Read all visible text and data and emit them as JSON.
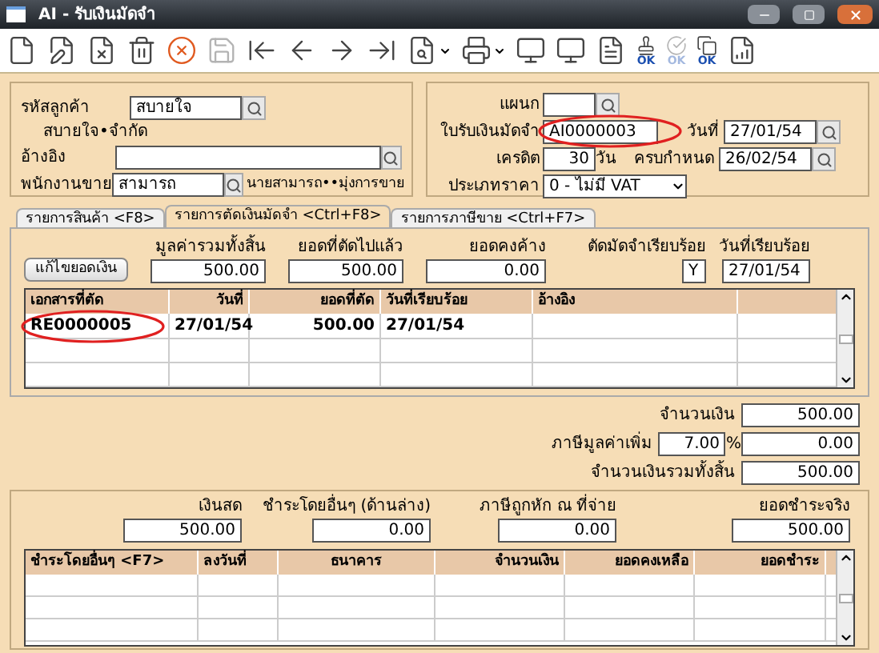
{
  "window": {
    "title": "AI - รับเงินมัดจำ"
  },
  "toolbar": [
    {
      "kind": "new",
      "disabled": false
    },
    {
      "kind": "edit",
      "disabled": false
    },
    {
      "kind": "void",
      "disabled": false
    },
    {
      "kind": "trash",
      "disabled": false
    },
    {
      "kind": "cancel",
      "disabled": false
    },
    {
      "kind": "save",
      "disabled": true
    },
    {
      "kind": "first",
      "disabled": false
    },
    {
      "kind": "prev",
      "disabled": false
    },
    {
      "kind": "next",
      "disabled": false
    },
    {
      "kind": "last",
      "disabled": false
    },
    {
      "kind": "find",
      "disabled": false,
      "dropdown": true
    },
    {
      "kind": "print",
      "disabled": false,
      "dropdown": true
    },
    {
      "kind": "screen",
      "disabled": false
    },
    {
      "kind": "screen",
      "disabled": false
    },
    {
      "kind": "form",
      "disabled": false
    },
    {
      "kind": "stamp",
      "disabled": false,
      "label": "OK"
    },
    {
      "kind": "approve",
      "disabled": true,
      "label": "OK"
    },
    {
      "kind": "copy",
      "disabled": false,
      "label": "OK"
    },
    {
      "kind": "report",
      "disabled": false
    }
  ],
  "customer": {
    "label": "รหัสลูกค้า",
    "value": "สบายใจ",
    "name": "สบายใจ•จำกัด"
  },
  "reference": {
    "label": "อ้างอิง"
  },
  "salesperson": {
    "label": "พนักงานขาย",
    "value": "สามารถ",
    "name": "นายสามารถ••มุ่งการขาย"
  },
  "department": {
    "label": "แผนก"
  },
  "receipt_no": {
    "label": "ใบรับเงินมัดจำ",
    "value": "AI0000003",
    "circled": true
  },
  "date": {
    "label": "วันที่",
    "value": "27/01/54"
  },
  "credit": {
    "label": "เครดิต",
    "value": "30",
    "unit": "วัน"
  },
  "due": {
    "label": "ครบกำหนด",
    "value": "26/02/54"
  },
  "price_type": {
    "label": "ประเภทราคา",
    "value": "0 - ไม่มี VAT"
  },
  "tabs": [
    {
      "label": "รายการสินค้า <F8>",
      "selected": false
    },
    {
      "label": "รายการตัดเงินมัดจำ <Ctrl+F8>",
      "selected": true
    },
    {
      "label": "รายการภาษีขาย <Ctrl+F7>",
      "selected": false
    }
  ],
  "edit_button": "แก้ไขยอดเงิน",
  "summary": [
    {
      "label": "มูลค่ารวมทั้งสิ้น",
      "value": "500.00"
    },
    {
      "label": "ยอดที่ตัดไปแล้ว",
      "value": "500.00"
    },
    {
      "label": "ยอดคงค้าง",
      "value": "0.00"
    }
  ],
  "settled": {
    "label": "ตัดมัดจำเรียบร้อย",
    "value": "Y"
  },
  "settled_date": {
    "label": "วันที่เรียบร้อย",
    "value": "27/01/54"
  },
  "deposit_table": {
    "columns": [
      "เอกสารที่ตัด",
      "วันที่",
      "ยอดที่ตัด",
      "วันที่เรียบร้อย",
      "อ้างอิง"
    ],
    "rows": [
      {
        "document": "RE0000005",
        "date": "27/01/54",
        "amount": "500.00",
        "done_date": "27/01/54",
        "circled": true
      }
    ]
  },
  "totals": {
    "amount": {
      "label": "จำนวนเงิน",
      "value": "500.00"
    },
    "vat": {
      "label": "ภาษีมูลค่าเพิ่ม",
      "rate": "7.00",
      "percent": "%",
      "value": "0.00"
    },
    "total": {
      "label": "จำนวนเงินรวมทั้งสิ้น",
      "value": "500.00"
    }
  },
  "payment": [
    {
      "label": "เงินสด",
      "value": "500.00"
    },
    {
      "label": "ชำระโดยอื่นๆ (ด้านล่าง)",
      "value": "0.00"
    },
    {
      "label": "ภาษีถูกหัก ณ ที่จ่าย",
      "value": "0.00"
    },
    {
      "label": "ยอดชำระจริง",
      "value": "500.00"
    }
  ],
  "payment_table": {
    "columns": [
      "ชำระโดยอื่นๆ <F7>",
      "ลงวันที่",
      "ธนาคาร",
      "จำนวนเงิน",
      "ยอดคงเหลือ",
      "ยอดชำระ"
    ]
  }
}
